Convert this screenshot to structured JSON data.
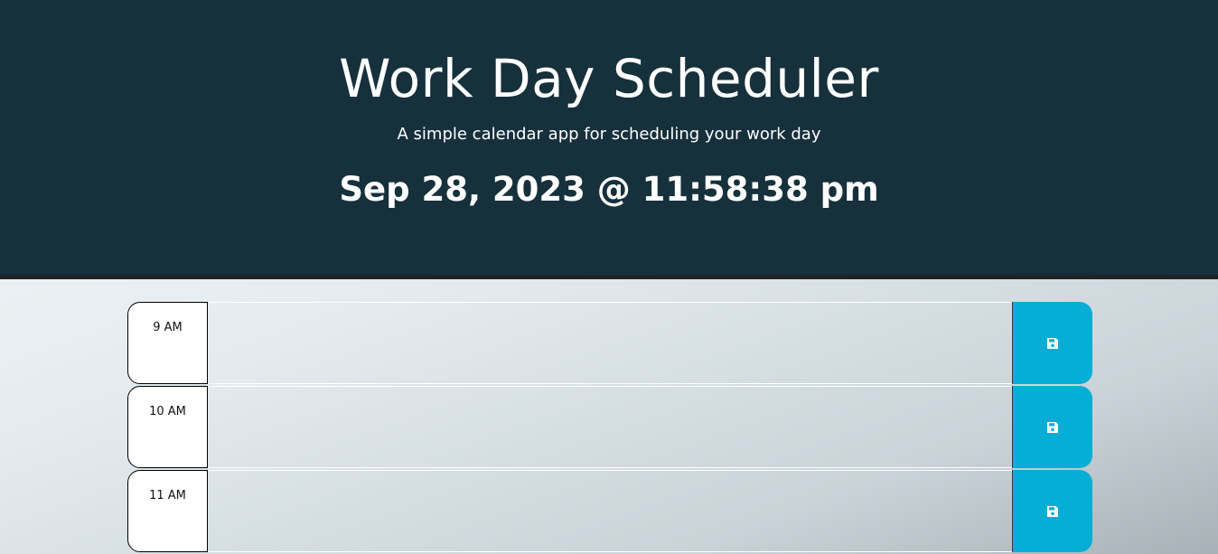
{
  "header": {
    "title": "Work Day Scheduler",
    "subtitle": "A simple calendar app for scheduling your work day",
    "current_datetime": "Sep 28, 2023 @ 11:58:38 pm"
  },
  "colors": {
    "header_bg": "#16303c",
    "save_button": "#06aed5"
  },
  "time_blocks": [
    {
      "hour": "9 AM",
      "description": "",
      "save_icon": "floppy-disk-icon"
    },
    {
      "hour": "10 AM",
      "description": "",
      "save_icon": "floppy-disk-icon"
    },
    {
      "hour": "11 AM",
      "description": "",
      "save_icon": "floppy-disk-icon"
    }
  ]
}
